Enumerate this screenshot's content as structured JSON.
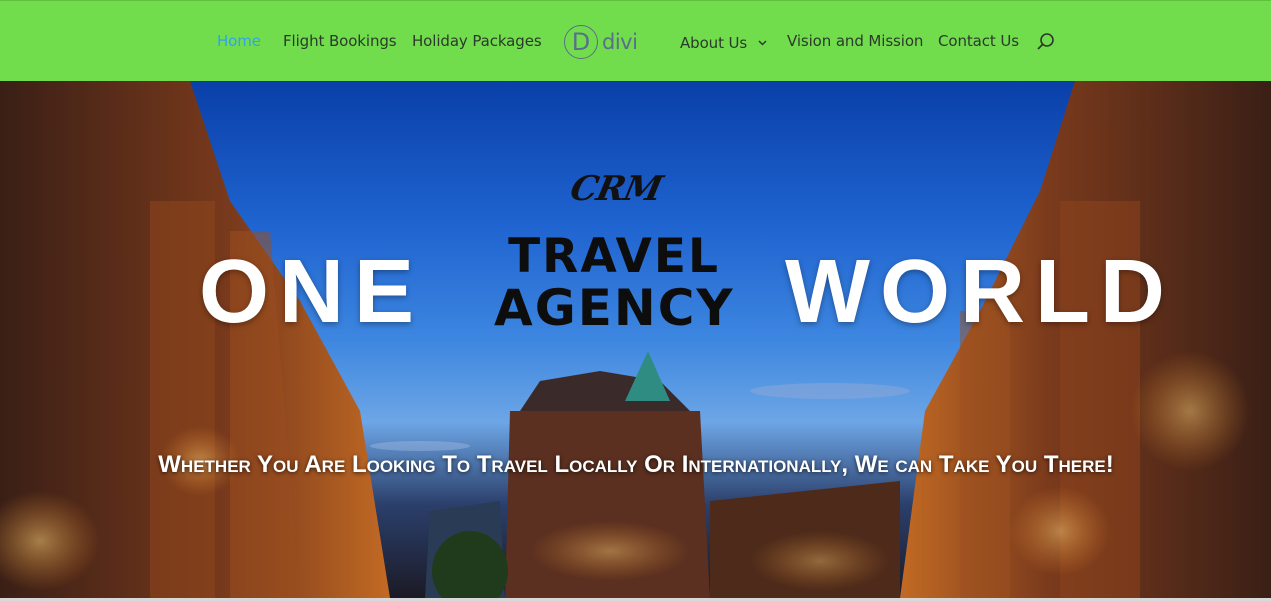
{
  "nav": {
    "items_left": [
      "Home",
      "Flight Bookings",
      "Holiday Packages"
    ],
    "logo_text": "divi",
    "logo_letter": "D",
    "items_right": [
      "About Us",
      "Vision and Mission",
      "Contact Us"
    ],
    "active_item": "Home",
    "search_icon": "search-icon",
    "dropdown_icon": "chevron-down-icon"
  },
  "hero": {
    "word_left": "ONE",
    "word_right": "WORLD",
    "crm_text": "CRM",
    "agency_line1": "TRAVEL",
    "agency_line2": "AGENCY",
    "tagline": "Whether You Are Looking To Travel Locally Or Internationally, We can Take You There!"
  },
  "colors": {
    "header_bg": "#72dd4c",
    "active_link": "#2ea3f2",
    "nav_text": "#2b3a2b"
  }
}
